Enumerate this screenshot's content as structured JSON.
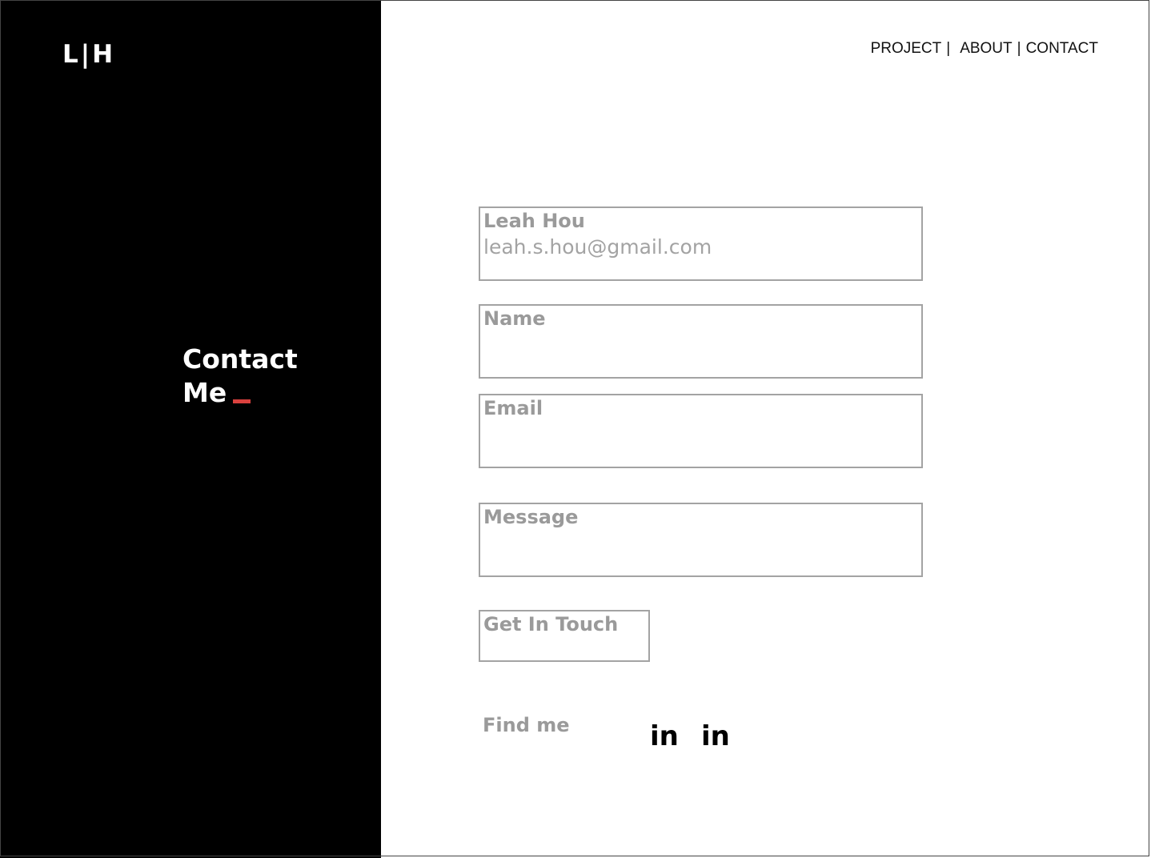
{
  "brand": {
    "logo": "L|H"
  },
  "nav": {
    "items": [
      {
        "label": "PROJECT"
      },
      {
        "label": "ABOUT"
      },
      {
        "label": "CONTACT"
      }
    ],
    "separator": "|"
  },
  "hero": {
    "line1": "Contact",
    "line2": "Me",
    "accent_color": "#d9413e"
  },
  "contact_card": {
    "name": "Leah Hou",
    "email": "leah.s.hou@gmail.com"
  },
  "form": {
    "name_label": "Name",
    "email_label": "Email",
    "message_label": "Message",
    "submit_label": "Get In Touch"
  },
  "social": {
    "label": "Find me",
    "links": [
      {
        "icon": "linkedin-icon",
        "text": "in"
      },
      {
        "icon": "linkedin-icon",
        "text": "in"
      }
    ]
  }
}
